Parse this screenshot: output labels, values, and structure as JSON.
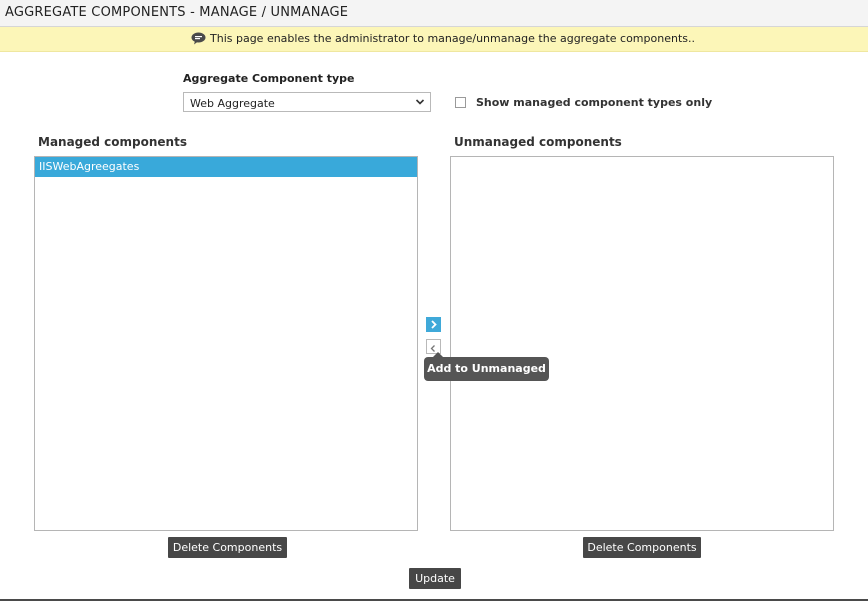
{
  "header": {
    "title": "AGGREGATE COMPONENTS - MANAGE / UNMANAGE"
  },
  "info": {
    "icon": "speech-bubble-icon",
    "message": "This page enables the administrator to manage/unmanage the aggregate components.."
  },
  "filter": {
    "type_label": "Aggregate Component type",
    "type_value": "Web Aggregate",
    "show_managed_label": "Show managed component types only",
    "show_managed_checked": false
  },
  "managed": {
    "title": "Managed components",
    "items": [
      {
        "label": "IISWebAgreegates",
        "selected": true
      }
    ],
    "delete_label": "Delete Components"
  },
  "unmanaged": {
    "title": "Unmanaged components",
    "items": [],
    "delete_label": "Delete Components"
  },
  "move": {
    "right_icon": "chevron-right-icon",
    "left_icon": "chevron-left-icon",
    "tooltip": "Add to Unmanaged"
  },
  "actions": {
    "update_label": "Update"
  },
  "colors": {
    "accent": "#39a9da",
    "info_background": "#fcf6b8",
    "button_background": "#474747"
  }
}
